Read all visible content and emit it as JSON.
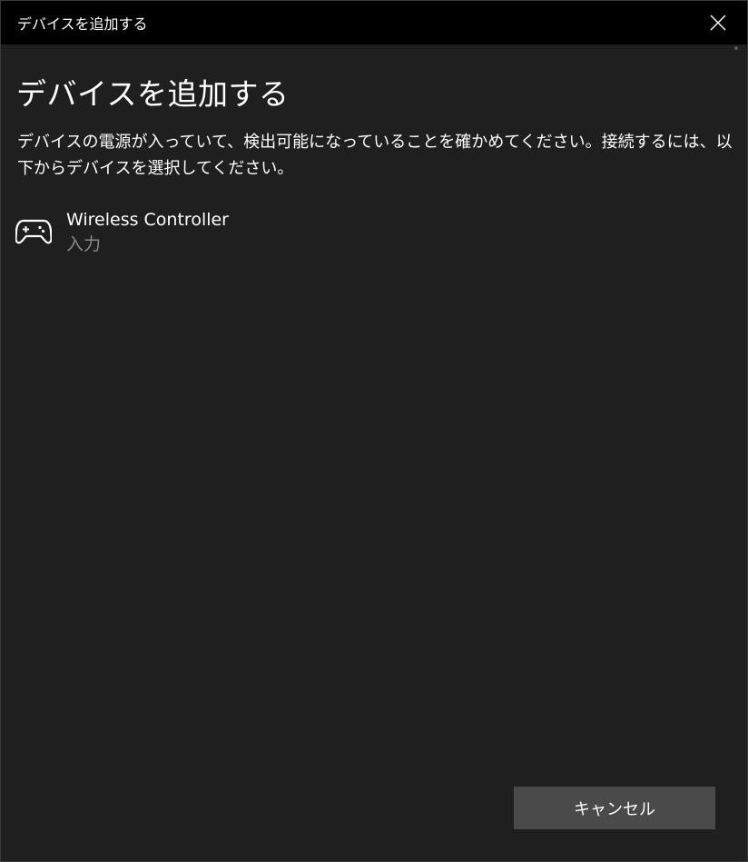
{
  "window": {
    "title": "デバイスを追加する"
  },
  "main": {
    "heading": "デバイスを追加する",
    "description": "デバイスの電源が入っていて、検出可能になっていることを確かめてください。接続するには、以下からデバイスを選択してください。"
  },
  "devices": [
    {
      "name": "Wireless Controller",
      "type": "入力",
      "icon": "gamepad-icon"
    }
  ],
  "footer": {
    "cancel_label": "キャンセル"
  },
  "colors": {
    "titlebar": "#000000",
    "background": "#1f1f1f",
    "button": "#4a4a4a",
    "secondary_text": "#8a8a8a"
  }
}
